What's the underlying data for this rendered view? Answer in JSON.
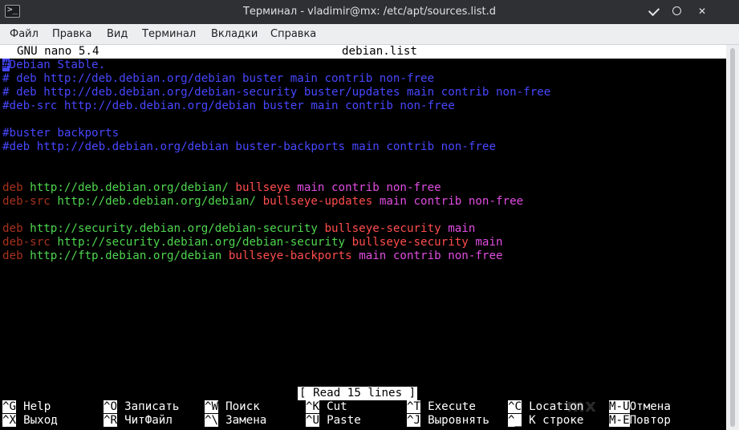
{
  "window": {
    "title": "Терминал - vladimir@mx: /etc/apt/sources.list.d",
    "app_icon_glyph": ">_"
  },
  "menu": [
    "Файл",
    "Правка",
    "Вид",
    "Терминал",
    "Вкладки",
    "Справка"
  ],
  "nano": {
    "version": "GNU nano 5.4",
    "filename": "debian.list",
    "status": "[ Read 15 lines ]"
  },
  "lines": [
    [
      {
        "t": "#",
        "c": "cursor"
      },
      {
        "t": "Debian Stable.",
        "c": "c-comment"
      }
    ],
    [
      {
        "t": "# deb http://deb.debian.org/debian buster main contrib non-free",
        "c": "c-comment"
      }
    ],
    [
      {
        "t": "# deb http://deb.debian.org/debian-security buster/updates main contrib non-free",
        "c": "c-comment"
      }
    ],
    [
      {
        "t": "#deb-src http://deb.debian.org/debian buster main contrib non-free",
        "c": "c-comment"
      }
    ],
    [],
    [
      {
        "t": "#buster backports",
        "c": "c-comment"
      }
    ],
    [
      {
        "t": "#deb http://deb.debian.org/debian buster-backports main contrib non-free",
        "c": "c-comment"
      }
    ],
    [],
    [],
    [
      {
        "t": "deb ",
        "c": "c-grey"
      },
      {
        "t": "http://deb.debian.org/debian/ ",
        "c": "c-green"
      },
      {
        "t": "bullseye ",
        "c": "c-red"
      },
      {
        "t": "main contrib non-free",
        "c": "c-mag"
      }
    ],
    [
      {
        "t": "deb-src ",
        "c": "c-grey"
      },
      {
        "t": "http://deb.debian.org/debian/ ",
        "c": "c-green"
      },
      {
        "t": "bullseye-updates ",
        "c": "c-red"
      },
      {
        "t": "main contrib non-free",
        "c": "c-mag"
      }
    ],
    [],
    [
      {
        "t": "deb ",
        "c": "c-grey"
      },
      {
        "t": "http://security.debian.org/debian-security ",
        "c": "c-green"
      },
      {
        "t": "bullseye-security ",
        "c": "c-red"
      },
      {
        "t": "main",
        "c": "c-mag"
      }
    ],
    [
      {
        "t": "deb-src ",
        "c": "c-grey"
      },
      {
        "t": "http://security.debian.org/debian-security ",
        "c": "c-green"
      },
      {
        "t": "bullseye-security ",
        "c": "c-red"
      },
      {
        "t": "main",
        "c": "c-mag"
      }
    ],
    [
      {
        "t": "deb ",
        "c": "c-grey"
      },
      {
        "t": "http://ftp.debian.org/debian ",
        "c": "c-green"
      },
      {
        "t": "bullseye-backports ",
        "c": "c-red"
      },
      {
        "t": "main contrib non-free",
        "c": "c-mag"
      }
    ]
  ],
  "shortcuts": [
    [
      {
        "key": "^G",
        "label": "Help"
      },
      {
        "key": "^O",
        "label": "Записать"
      },
      {
        "key": "^W",
        "label": "Поиск"
      },
      {
        "key": "^K",
        "label": "Cut"
      },
      {
        "key": "^T",
        "label": "Execute"
      },
      {
        "key": "^C",
        "label": "Location"
      },
      {
        "key": "M-U",
        "label": "Отмена"
      }
    ],
    [
      {
        "key": "^X",
        "label": "Выход"
      },
      {
        "key": "^R",
        "label": "ЧитФайл"
      },
      {
        "key": "^\\",
        "label": "Замена"
      },
      {
        "key": "^U",
        "label": "Paste"
      },
      {
        "key": "^J",
        "label": "Выровнять"
      },
      {
        "key": "^_",
        "label": "К строке"
      },
      {
        "key": "M-E",
        "label": "Повтор"
      }
    ]
  ],
  "watermark": "mx"
}
